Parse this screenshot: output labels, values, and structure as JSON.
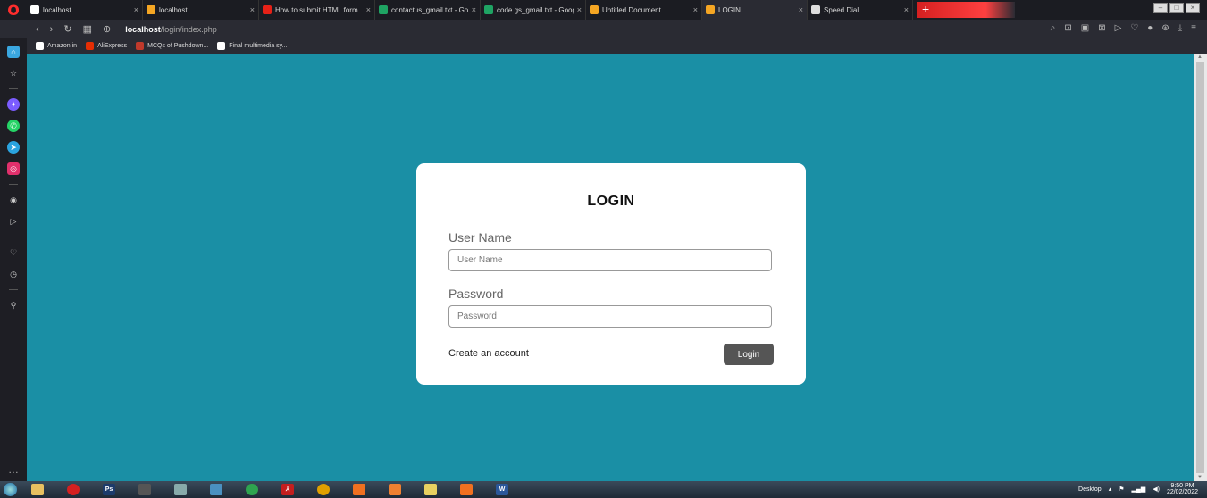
{
  "browser": {
    "tabs": [
      {
        "label": "localhost",
        "color": "#ffffff",
        "active": false
      },
      {
        "label": "localhost",
        "color": "#f5a623",
        "active": false
      },
      {
        "label": "How to submit HTML form",
        "color": "#e62117",
        "active": false
      },
      {
        "label": "contactus_gmail.txt - Goog",
        "color": "#1fa463",
        "active": false
      },
      {
        "label": "code.gs_gmail.txt - Google",
        "color": "#1fa463",
        "active": false
      },
      {
        "label": "Untitled Document",
        "color": "#f5a623",
        "active": false
      },
      {
        "label": "LOGIN",
        "color": "#f5a623",
        "active": true
      },
      {
        "label": "Speed Dial",
        "color": "#dddddd",
        "active": false
      }
    ],
    "new_tab_label": "+",
    "url_host": "localhost",
    "url_path": "/login/index.php",
    "bookmarks": [
      {
        "label": "Amazon.in",
        "color": "#ffffff"
      },
      {
        "label": "AliExpress",
        "color": "#e62e04"
      },
      {
        "label": "MCQs of Pushdown...",
        "color": "#c0392b"
      },
      {
        "label": "Final multimedia sy...",
        "color": "#ffffff"
      }
    ]
  },
  "login": {
    "title": "LOGIN",
    "username_label": "User Name",
    "username_placeholder": "User Name",
    "password_label": "Password",
    "password_placeholder": "Password",
    "create_account_label": "Create an account",
    "login_button_label": "Login"
  },
  "taskbar": {
    "desktop_label": "Desktop",
    "time": "9:50 PM",
    "date": "22/02/2022"
  },
  "colors": {
    "page_background": "#1a8fa5",
    "card_background": "#ffffff",
    "login_button": "#555555"
  }
}
